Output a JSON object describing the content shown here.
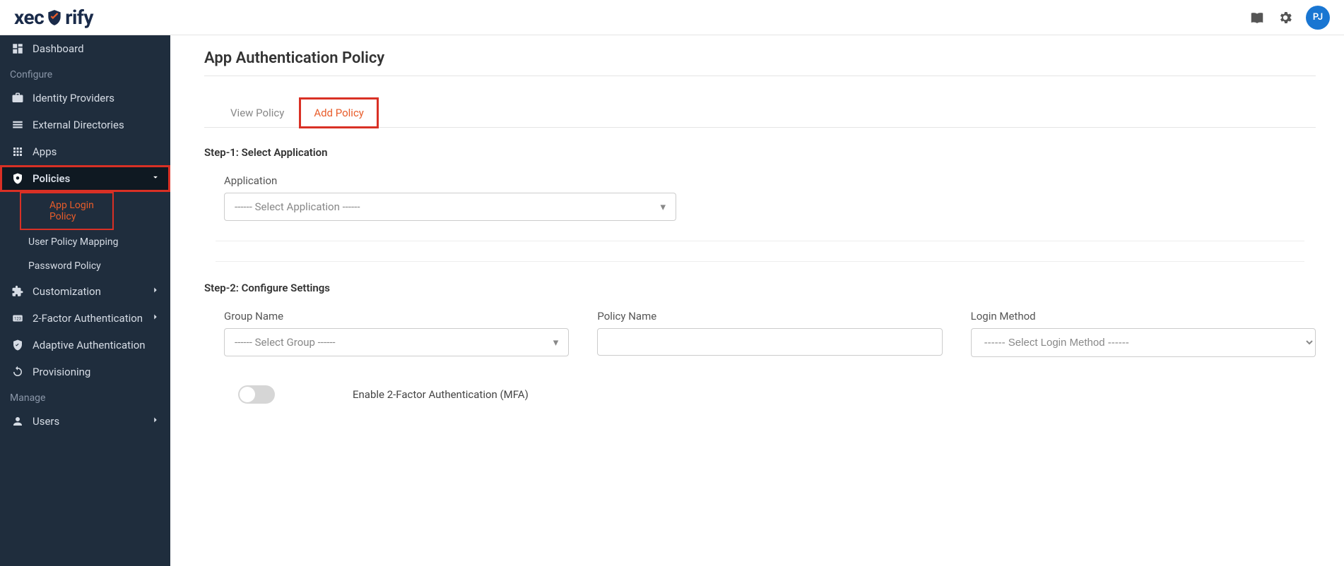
{
  "header": {
    "logo_pre": "xec",
    "logo_post": "rify",
    "avatar_initials": "PJ"
  },
  "sidebar": {
    "dashboard": "Dashboard",
    "section_configure": "Configure",
    "idp": "Identity Providers",
    "ext_dir": "External Directories",
    "apps": "Apps",
    "policies": "Policies",
    "policies_sub": {
      "app_login": "App Login Policy",
      "user_policy": "User Policy Mapping",
      "password_policy": "Password Policy"
    },
    "customization": "Customization",
    "twofa": "2-Factor Authentication",
    "adaptive": "Adaptive Authentication",
    "provisioning": "Provisioning",
    "section_manage": "Manage",
    "users": "Users"
  },
  "main": {
    "page_title": "App Authentication Policy",
    "tabs": {
      "view": "View Policy",
      "add": "Add Policy"
    },
    "step1": {
      "title": "Step-1: Select Application",
      "app_label": "Application",
      "app_placeholder": "------ Select Application ------"
    },
    "step2": {
      "title": "Step-2: Configure Settings",
      "group_label": "Group Name",
      "group_placeholder": "------ Select Group ------",
      "policy_label": "Policy Name",
      "login_label": "Login Method",
      "login_placeholder": "------ Select Login Method ------",
      "mfa_label": "Enable 2-Factor Authentication (MFA)"
    }
  }
}
